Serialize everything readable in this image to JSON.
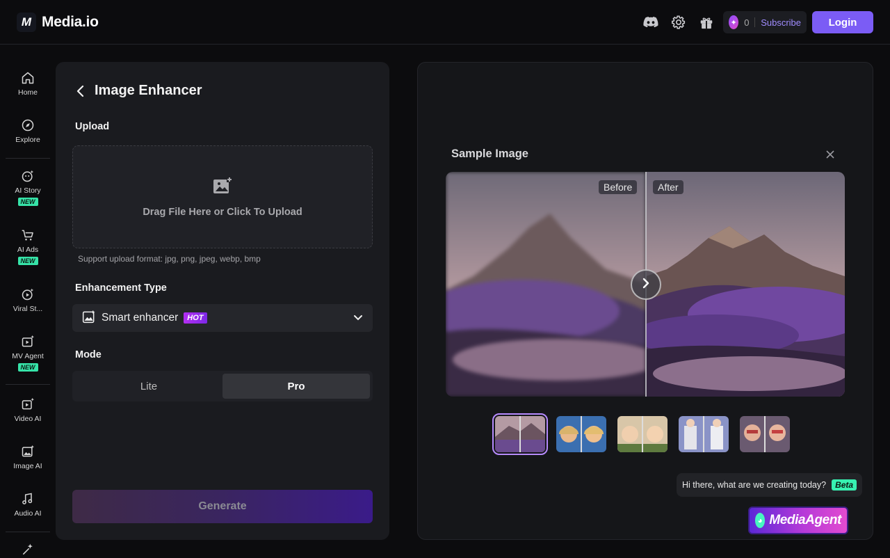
{
  "header": {
    "logo_mark": "M",
    "logo_text": "Media.io",
    "icons": [
      "discord-icon",
      "settings-icon",
      "gift-icon"
    ],
    "credits": "0",
    "subscribe": "Subscribe",
    "login": "Login"
  },
  "sidebar": {
    "items": [
      {
        "label": "Home",
        "icon": "home-icon"
      },
      {
        "label": "Explore",
        "icon": "compass-icon"
      },
      {
        "label": "AI Story",
        "icon": "ai-story-icon",
        "badge": "NEW"
      },
      {
        "label": "AI Ads",
        "icon": "cart-icon",
        "badge": "NEW"
      },
      {
        "label": "Viral St...",
        "icon": "viral-icon"
      },
      {
        "label": "MV Agent",
        "icon": "mv-agent-icon",
        "badge": "NEW"
      },
      {
        "label": "Video AI",
        "icon": "video-ai-icon"
      },
      {
        "label": "Image AI",
        "icon": "image-ai-icon"
      },
      {
        "label": "Audio AI",
        "icon": "audio-ai-icon"
      }
    ]
  },
  "tool": {
    "title": "Image Enhancer",
    "upload_label": "Upload",
    "upload_text": "Drag File Here or Click To Upload",
    "upload_hint": "Support upload format: jpg, png, jpeg, webp, bmp",
    "type_label": "Enhancement Type",
    "type_value": "Smart enhancer",
    "type_badge": "HOT",
    "mode_label": "Mode",
    "modes": [
      "Lite",
      "Pro"
    ],
    "active_mode": "Pro",
    "generate": "Generate"
  },
  "preview": {
    "title": "Sample Image",
    "before": "Before",
    "after": "After",
    "thumb_count": 5,
    "selected_thumb": 0
  },
  "assistant": {
    "greeting": "Hi there, what are we creating today?",
    "badge": "Beta",
    "name": "MediaAgent"
  },
  "colors": {
    "accent": "#7b5cf5",
    "new_badge": "#36e3a8",
    "hot_badge": "#b42ff3"
  }
}
